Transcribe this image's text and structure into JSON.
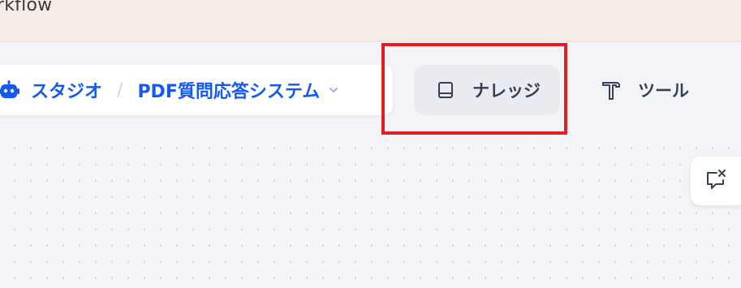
{
  "banner": {
    "text": "rkflow"
  },
  "breadcrumb": {
    "studio_label": "スタジオ",
    "separator": "/",
    "app_name": "PDF質問応答システム"
  },
  "nav": {
    "knowledge_label": "ナレッジ",
    "tools_label": "ツール"
  },
  "colors": {
    "accent": "#155aef",
    "highlight": "#e11d26",
    "banner_bg": "#f6ece8"
  },
  "icons": {
    "studio": "robot-icon",
    "app_dropdown": "chevron-down-icon",
    "knowledge": "book-icon",
    "tools": "hammer-icon",
    "comment": "message-close-icon"
  }
}
